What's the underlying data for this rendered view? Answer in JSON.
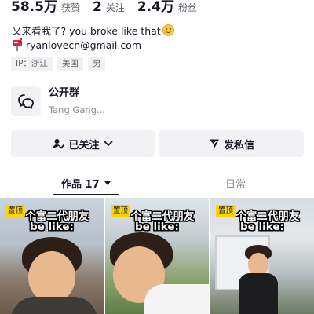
{
  "stats": [
    {
      "num": "58.5万",
      "label": "获赞"
    },
    {
      "num": "2",
      "label": "关注"
    },
    {
      "num": "2.4万",
      "label": "粉丝"
    }
  ],
  "bio": {
    "line1": "又来看我了? you broke like that",
    "email": "ryanlovecn@gmail.com"
  },
  "tags": [
    "IP：浙江",
    "美国",
    "男"
  ],
  "group": {
    "title": "公开群",
    "subtitle": "Tang Gang..."
  },
  "buttons": {
    "follow": "已关注",
    "message": "发私信"
  },
  "tabs": {
    "works": "作品 17",
    "daily": "日常"
  },
  "videos": [
    {
      "pin": "置顶",
      "cap1": "一个富二代朋友",
      "cap2": "be like:"
    },
    {
      "pin": "置顶",
      "cap1": "一个富二代朋友",
      "cap2": "be like:"
    },
    {
      "pin": "置顶",
      "cap1": "一个富二代朋友",
      "cap2": "be like:"
    }
  ],
  "icons": {
    "smile": "smile-emoji-icon",
    "mailbox": "mailbox-icon",
    "group": "chat-bubbles-icon",
    "follow": "user-check-icon",
    "chevron": "chevron-down-icon",
    "message": "send-icon",
    "caret": "caret-down-icon"
  },
  "colors": {
    "pin_red": "#fe2c55",
    "pin_yellow": "#ffd500",
    "text": "#161823",
    "muted": "#8a8b91",
    "button_bg": "#f2f2f4"
  }
}
